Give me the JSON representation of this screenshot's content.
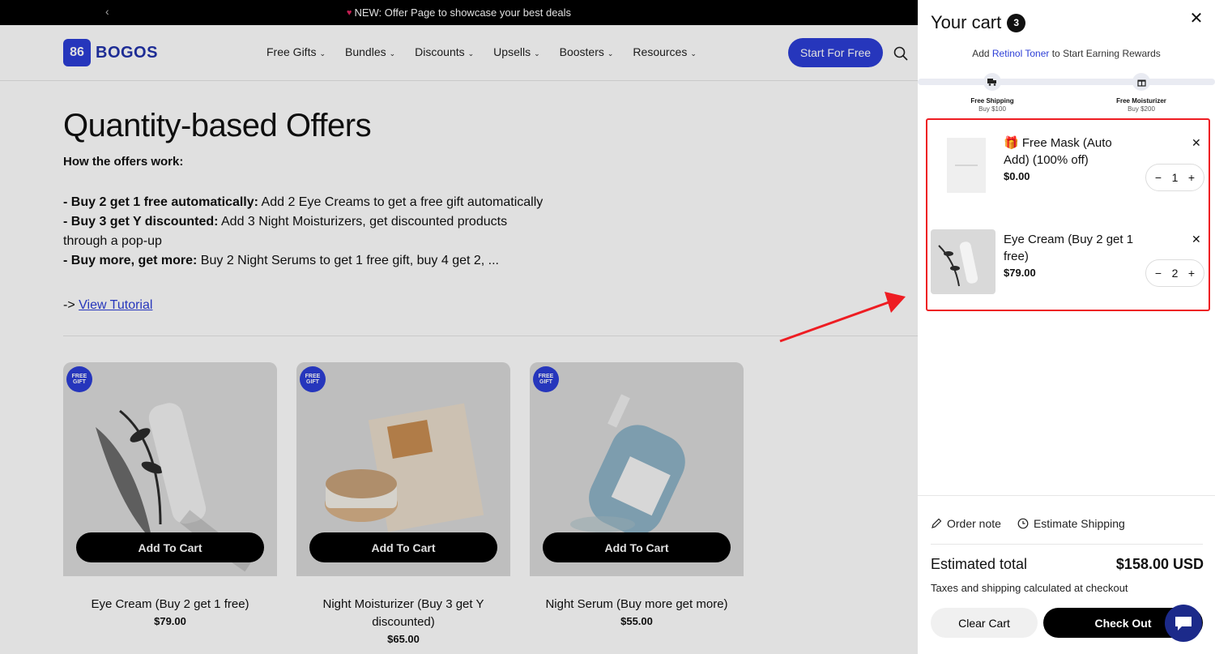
{
  "announcement": {
    "prev_icon": "chevron-left-icon",
    "heart_icon": "heart-icon",
    "text": "NEW: Offer Page to showcase your best deals"
  },
  "header": {
    "logo_text": "BOGOS",
    "nav": [
      {
        "label": "Free Gifts"
      },
      {
        "label": "Bundles"
      },
      {
        "label": "Discounts"
      },
      {
        "label": "Upsells"
      },
      {
        "label": "Boosters"
      },
      {
        "label": "Resources"
      }
    ],
    "cta": "Start For Free",
    "search_icon": "search-icon"
  },
  "main": {
    "title": "Quantity-based Offers",
    "how_heading": "How the offers work:",
    "offers": [
      {
        "bold": "- Buy 2 get 1 free automatically:",
        "text": " Add 2 Eye Creams to get a free gift automatically"
      },
      {
        "bold": "- Buy 3 get Y discounted:",
        "text": " Add 3 Night Moisturizers, get discounted products through a pop-up"
      },
      {
        "bold": "- Buy more, get more:",
        "text": " Buy 2 Night Serums to get 1 free gift, buy 4 get 2, ..."
      }
    ],
    "tutorial_prefix": "-> ",
    "tutorial_link": "View Tutorial",
    "products": [
      {
        "badge": "FREE GIFT",
        "button": "Add To Cart",
        "name": "Eye Cream (Buy 2 get 1 free)",
        "price": "$79.00"
      },
      {
        "badge": "FREE GIFT",
        "button": "Add To Cart",
        "name": "Night Moisturizer (Buy 3 get Y discounted)",
        "price": "$65.00"
      },
      {
        "badge": "FREE GIFT",
        "button": "Add To Cart",
        "name": "Night Serum (Buy more get more)",
        "price": "$55.00"
      }
    ]
  },
  "cart": {
    "title": "Your cart",
    "count": "3",
    "reward_before": "Add ",
    "reward_product": "Retinol Toner",
    "reward_after": " to Start Earning Rewards",
    "milestones": [
      {
        "icon": "truck-icon",
        "title": "Free Shipping",
        "sub": "Buy $100"
      },
      {
        "icon": "gift-icon",
        "title": "Free Moisturizer",
        "sub": "Buy $200"
      }
    ],
    "items": [
      {
        "gift_emoji": "🎁",
        "name": "Free Mask (Auto Add) (100% off)",
        "price": "$0.00",
        "qty": "1"
      },
      {
        "gift_emoji": "",
        "name": "Eye Cream (Buy 2 get 1 free)",
        "price": "$79.00",
        "qty": "2"
      }
    ],
    "order_note": "Order note",
    "estimate_shipping": "Estimate Shipping",
    "estimated_total_label": "Estimated total",
    "estimated_total": "$158.00 USD",
    "tax_note": "Taxes and shipping calculated at checkout",
    "clear_button": "Clear Cart",
    "checkout_button": "Check Out"
  },
  "colors": {
    "brand": "#2c3ed6",
    "highlight_box": "#ee1d23",
    "arrow": "#ee1d23"
  }
}
